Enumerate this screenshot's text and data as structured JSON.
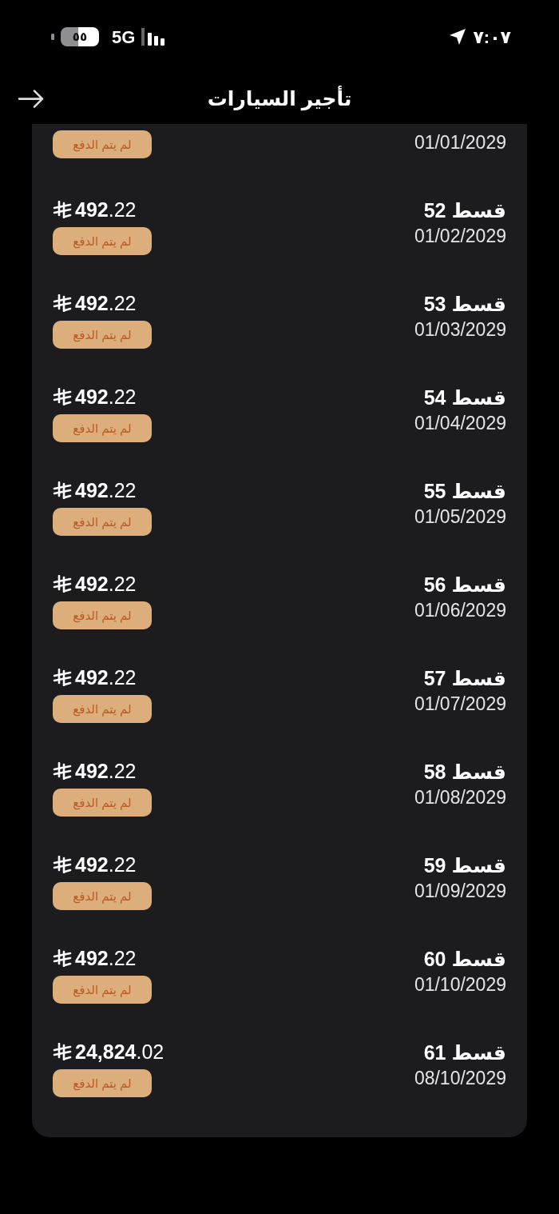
{
  "status_bar": {
    "battery": "٥٥",
    "network": "5G",
    "time": "٧:٠٧"
  },
  "header": {
    "title": "تأجير السيارات"
  },
  "installments": [
    {
      "date": "01/01/2029",
      "status": "لم يتم الدفع",
      "paid": false
    },
    {
      "label": "قسط 52",
      "date": "01/02/2029",
      "amount": "**492**.22",
      "status": "لم يتم الدفع",
      "paid": false
    },
    {
      "label": "قسط 53",
      "date": "01/03/2029",
      "amount": "**492**.22",
      "status": "لم يتم الدفع",
      "paid": false
    },
    {
      "label": "قسط 54",
      "date": "01/04/2029",
      "amount": "**492**.22",
      "status": "لم يتم الدفع",
      "paid": false
    },
    {
      "label": "قسط 55",
      "date": "01/05/2029",
      "amount": "**492**.22",
      "status": "لم يتم الدفع",
      "paid": false
    },
    {
      "label": "قسط 56",
      "date": "01/06/2029",
      "amount": "**492**.22",
      "status": "لم يتم الدفع",
      "paid": false
    },
    {
      "label": "قسط 57",
      "date": "01/07/2029",
      "amount": "**492**.22",
      "status": "لم يتم الدفع",
      "paid": false
    },
    {
      "label": "قسط 58",
      "date": "01/08/2029",
      "amount": "**492**.22",
      "status": "لم يتم الدفع",
      "paid": false
    },
    {
      "label": "قسط 59",
      "date": "01/09/2029",
      "amount": "**492**.22",
      "status": "لم يتم الدفع",
      "paid": false
    },
    {
      "label": "قسط 60",
      "date": "01/10/2029",
      "amount": "**492**.22",
      "status": "لم يتم الدفع",
      "paid": false
    },
    {
      "label": "قسط 61",
      "date": "08/10/2029",
      "amount": "**24,824**.02",
      "status": "لم يتم الدفع",
      "paid": false
    }
  ]
}
